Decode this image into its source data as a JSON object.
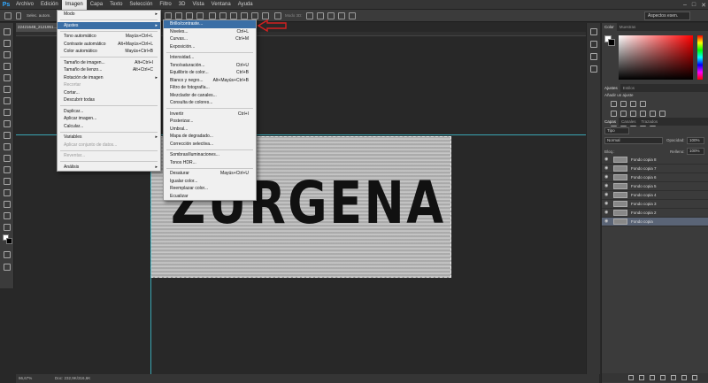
{
  "app": {
    "logo": "Ps"
  },
  "menubar": {
    "items": [
      "Archivo",
      "Edición",
      "Imagen",
      "Capa",
      "Texto",
      "Selección",
      "Filtro",
      "3D",
      "Vista",
      "Ventana",
      "Ayuda"
    ],
    "active_index": 2
  },
  "options": {
    "label": "Selec. autom.",
    "align_label": "Modo 3D:",
    "workspace": "Aspectos esen."
  },
  "document": {
    "tab_title": "2242164B_2121951...",
    "image_text": "ZURGENA",
    "zoom": "66,67%",
    "status": "Doc: 232,9K/316,6K"
  },
  "imagen_menu": [
    {
      "label": "Modo",
      "shortcut": "",
      "submenu": true
    },
    {
      "sep": true
    },
    {
      "label": "Ajustes",
      "shortcut": "",
      "submenu": true,
      "highlight": true
    },
    {
      "sep": true
    },
    {
      "label": "Tono automático",
      "shortcut": "Mayús+Ctrl+L"
    },
    {
      "label": "Contraste automático",
      "shortcut": "Alt+Mayús+Ctrl+L"
    },
    {
      "label": "Color automático",
      "shortcut": "Mayús+Ctrl+B"
    },
    {
      "sep": true
    },
    {
      "label": "Tamaño de imagen...",
      "shortcut": "Alt+Ctrl+I"
    },
    {
      "label": "Tamaño de lienzo...",
      "shortcut": "Alt+Ctrl+C"
    },
    {
      "label": "Rotación de imagen",
      "shortcut": "",
      "submenu": true
    },
    {
      "label": "Recortar",
      "shortcut": "",
      "disabled": true
    },
    {
      "label": "Cortar...",
      "shortcut": ""
    },
    {
      "label": "Descubrir todas",
      "shortcut": ""
    },
    {
      "sep": true
    },
    {
      "label": "Duplicar...",
      "shortcut": ""
    },
    {
      "label": "Aplicar imagen...",
      "shortcut": ""
    },
    {
      "label": "Calcular...",
      "shortcut": ""
    },
    {
      "sep": true
    },
    {
      "label": "Variables",
      "shortcut": "",
      "submenu": true
    },
    {
      "label": "Aplicar conjunto de datos...",
      "shortcut": "",
      "disabled": true
    },
    {
      "sep": true
    },
    {
      "label": "Reventar...",
      "shortcut": "",
      "disabled": true
    },
    {
      "sep": true
    },
    {
      "label": "Análisis",
      "shortcut": "",
      "submenu": true
    }
  ],
  "ajustes_menu": [
    {
      "label": "Brillo/contraste...",
      "shortcut": "",
      "highlight": true
    },
    {
      "label": "Niveles...",
      "shortcut": "Ctrl+L"
    },
    {
      "label": "Curvas...",
      "shortcut": "Ctrl+M"
    },
    {
      "label": "Exposición...",
      "shortcut": ""
    },
    {
      "sep": true
    },
    {
      "label": "Intensidad...",
      "shortcut": ""
    },
    {
      "label": "Tono/saturación...",
      "shortcut": "Ctrl+U"
    },
    {
      "label": "Equilibrio de color...",
      "shortcut": "Ctrl+B"
    },
    {
      "label": "Blanco y negro...",
      "shortcut": "Alt+Mayús+Ctrl+B"
    },
    {
      "label": "Filtro de fotografía...",
      "shortcut": ""
    },
    {
      "label": "Mezclador de canales...",
      "shortcut": ""
    },
    {
      "label": "Consulta de colores...",
      "shortcut": ""
    },
    {
      "sep": true
    },
    {
      "label": "Invertir",
      "shortcut": "Ctrl+I"
    },
    {
      "label": "Posterizar...",
      "shortcut": ""
    },
    {
      "label": "Umbral...",
      "shortcut": ""
    },
    {
      "label": "Mapa de degradado...",
      "shortcut": ""
    },
    {
      "label": "Corrección selectiva...",
      "shortcut": ""
    },
    {
      "sep": true
    },
    {
      "label": "Sombras/iluminaciones...",
      "shortcut": ""
    },
    {
      "label": "Tonos HDR...",
      "shortcut": ""
    },
    {
      "sep": true
    },
    {
      "label": "Desaturar",
      "shortcut": "Mayús+Ctrl+U"
    },
    {
      "label": "Igualar color...",
      "shortcut": ""
    },
    {
      "label": "Reemplazar color...",
      "shortcut": ""
    },
    {
      "label": "Ecualizar",
      "shortcut": ""
    }
  ],
  "panels": {
    "color_tabs": [
      "Color",
      "Muestras"
    ],
    "adjust_tabs": [
      "Ajustes",
      "Estilos"
    ],
    "adjust_title": "Añadir un ajuste",
    "layers_tabs": [
      "Capas",
      "Canales",
      "Trazados"
    ],
    "kind_filter": "Tipo",
    "blend_mode": "Normal",
    "opacity_label": "Opacidad:",
    "opacity_value": "100%",
    "lock_label": "Bloq.:",
    "fill_label": "Relleno:",
    "fill_value": "100%",
    "layers": [
      "Fondo copia 8",
      "Fondo copia 7",
      "Fondo copia 6",
      "Fondo copia 5",
      "Fondo copia 4",
      "Fondo copia 3",
      "Fondo copia 2",
      "Fondo copia"
    ],
    "selected_layer": 7
  },
  "colors": {
    "accent": "#3a6ea5",
    "guide": "#3ec6d6",
    "annotation": "#d42020"
  }
}
